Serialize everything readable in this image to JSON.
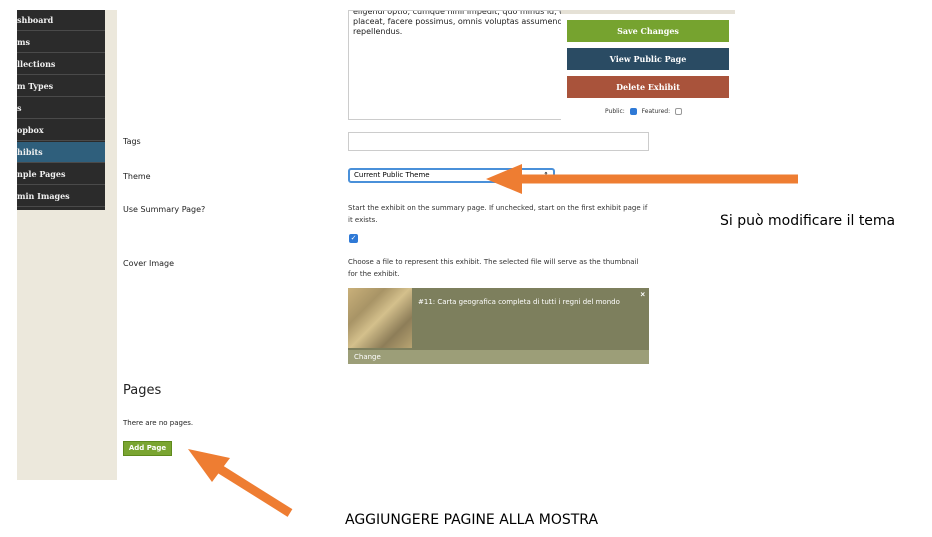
{
  "sidebar": {
    "items": [
      {
        "label": "shboard"
      },
      {
        "label": "ms"
      },
      {
        "label": "llections"
      },
      {
        "label": "m Types"
      },
      {
        "label": "s"
      },
      {
        "label": "opbox"
      },
      {
        "label": "hibits",
        "active": true
      },
      {
        "label": "nple Pages"
      },
      {
        "label": "min Images"
      }
    ]
  },
  "form": {
    "description_text_top": "eligendi optio, cumque nihil impedit, quo minus id, quod maxime placeat, facere possimus, omnis voluptas assumenda est, omnis dolor repellendus.",
    "tags_label": "Tags",
    "theme_label": "Theme",
    "theme_value": "Current Public Theme",
    "summary_label": "Use Summary Page?",
    "summary_hint": "Start the exhibit on the summary page. If unchecked, start on the first exhibit page if it exists.",
    "cover_label": "Cover Image",
    "cover_hint": "Choose a file to represent this exhibit. The selected file will serve as the thumbnail for the exhibit.",
    "cover_title": "#11: Carta geografica completa di tutti i regni del mondo",
    "cover_change": "Change",
    "pages_heading": "Pages",
    "no_pages": "There are no pages.",
    "add_page": "Add Page"
  },
  "panel": {
    "save": "Save Changes",
    "view": "View Public Page",
    "delete": "Delete Exhibit",
    "public_label": "Public:",
    "featured_label": "Featured:"
  },
  "annotations": {
    "right": "Si può modificare il tema",
    "bottom": "AGGIUNGERE PAGINE ALLA MOSTRA"
  },
  "colors": {
    "arrow": "#ee7d32",
    "save": "#76a32f",
    "view": "#2a4b63",
    "delete": "#a9533b"
  }
}
